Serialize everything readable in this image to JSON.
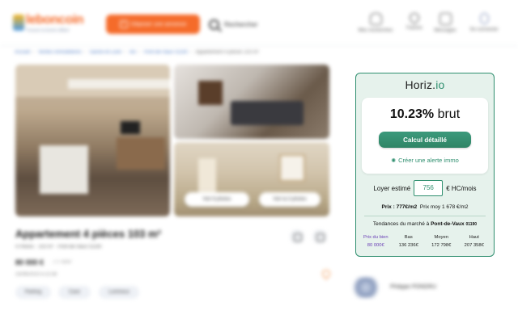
{
  "header": {
    "logo_text": "leboncoin",
    "logo_tagline": "Trouvez la bonne affaire",
    "deposit_label": "Déposer une annonce",
    "search_label": "Rechercher",
    "nav": [
      {
        "label": "Mes recherches",
        "icon": "bell-icon"
      },
      {
        "label": "Favoris",
        "icon": "heart-icon"
      },
      {
        "label": "Messages",
        "icon": "chat-icon"
      },
      {
        "label": "Se connecter",
        "icon": "user-icon"
      }
    ]
  },
  "breadcrumb": [
    "Accueil",
    "Ventes immobilières",
    "Saône-et-Loire",
    "Ain",
    "Pont-de-Vaux 01190",
    "Appartement 4 pièces 103 m²"
  ],
  "photos": {
    "see_photos_label": "Voir 8 photos",
    "virtual_visit_label": "Voir la 3 photos"
  },
  "listing": {
    "title": "Appartement 4 pièces 103 m²",
    "subtitle": "4 Pièces · 103 m² · Pont-de-Vaux 01190",
    "price": "80 000 €",
    "price_note": "777 €/m²",
    "date": "25/06/2023 à 11:58",
    "tags": [
      "Parking",
      "Cave",
      "Lumineux"
    ]
  },
  "widget": {
    "logo_main": "Horiz.",
    "logo_accent": "io",
    "yield_value": "10.23%",
    "yield_suffix": "brut",
    "calc_button": "Calcul détaillé",
    "alert_link": "Créer une alerte immo",
    "rent_label": "Loyer estimé",
    "rent_value": "756",
    "rent_unit": "€ HC/mois",
    "price_per_m2_label": "Prix : 777€/m2",
    "avg_price_label": "Prix moy 1 678 €/m2",
    "trend_prefix": "Tendances du marché à",
    "trend_city": "Pont-de-Vaux",
    "trend_zip": "01190",
    "trends": [
      {
        "label": "Prix du bien",
        "value": "80 000€"
      },
      {
        "label": "Bas",
        "value": "136 236€"
      },
      {
        "label": "Moyen",
        "value": "172 798€"
      },
      {
        "label": "Haut",
        "value": "207 358€"
      }
    ],
    "colors": {
      "accent": "#2f8f6f",
      "highlight": "#6a3fb5",
      "background": "#e6f2ec"
    }
  },
  "seller": {
    "name": "Philippe PONDRU"
  }
}
